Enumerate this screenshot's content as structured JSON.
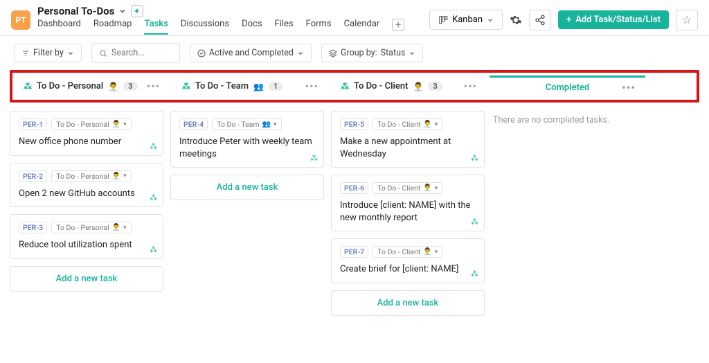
{
  "header": {
    "avatar": "PT",
    "title": "Personal To-Dos",
    "tabs": [
      "Dashboard",
      "Roadmap",
      "Tasks",
      "Discussions",
      "Docs",
      "Files",
      "Forms",
      "Calendar"
    ],
    "active_tab": "Tasks",
    "view_button": "Kanban",
    "primary_button": "Add Task/Status/List"
  },
  "toolbar": {
    "filter_label": "Filter by",
    "search_placeholder": "Search...",
    "active_label": "Active and Completed",
    "group_label": "Group by:",
    "group_value": "Status"
  },
  "columns": [
    {
      "name": "To Do - Personal",
      "emoji": "👨‍💼",
      "count": 3
    },
    {
      "name": "To Do - Team",
      "emoji": "👥",
      "count": 1
    },
    {
      "name": "To Do - Client",
      "emoji": "👨‍💼",
      "count": 3
    },
    {
      "name": "Completed"
    }
  ],
  "cards": {
    "personal": [
      {
        "id": "PER-1",
        "status": "To Do - Personal",
        "emoji": "👨‍💼",
        "title": "New office phone number"
      },
      {
        "id": "PER-2",
        "status": "To Do - Personal",
        "emoji": "👨‍💼",
        "title": "Open 2 new GitHub accounts"
      },
      {
        "id": "PER-3",
        "status": "To Do - Personal",
        "emoji": "👨‍💼",
        "title": "Reduce tool utilization spent"
      }
    ],
    "team": [
      {
        "id": "PER-4",
        "status": "To Do - Team",
        "emoji": "👥",
        "title": "Introduce Peter with weekly team meetings"
      }
    ],
    "client": [
      {
        "id": "PER-5",
        "status": "To Do - Client",
        "emoji": "👨‍💼",
        "title": "Make a new appointment at Wednesday"
      },
      {
        "id": "PER-6",
        "status": "To Do - Client",
        "emoji": "👨‍💼",
        "title": "Introduce [client: NAME] with the new monthly report"
      },
      {
        "id": "PER-7",
        "status": "To Do - Client",
        "emoji": "👨‍💼",
        "title": "Create brief for [client: NAME]"
      }
    ]
  },
  "labels": {
    "add_task": "Add a new task",
    "empty_completed": "There are no completed tasks."
  }
}
